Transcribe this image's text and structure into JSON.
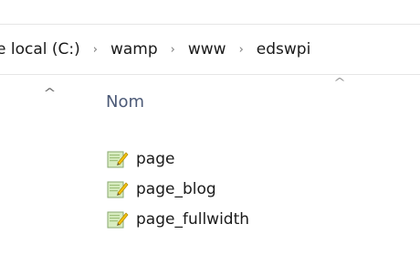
{
  "address": {
    "crumbs": [
      {
        "label": "e local (C:)"
      },
      {
        "label": "wamp"
      },
      {
        "label": "www"
      },
      {
        "label": "edswpi"
      }
    ],
    "separator": "›"
  },
  "nav": {
    "scroll_up_glyph": "^"
  },
  "columns": {
    "name_header": "Nom",
    "sort_glyph": "^"
  },
  "files": [
    {
      "name": "page",
      "icon": "php-file-icon"
    },
    {
      "name": "page_blog",
      "icon": "php-file-icon"
    },
    {
      "name": "page_fullwidth",
      "icon": "php-file-icon"
    }
  ],
  "colors": {
    "header_text": "#4c5a77",
    "icon_paper": "#d8ecc0",
    "icon_pencil": "#f2c10f"
  }
}
